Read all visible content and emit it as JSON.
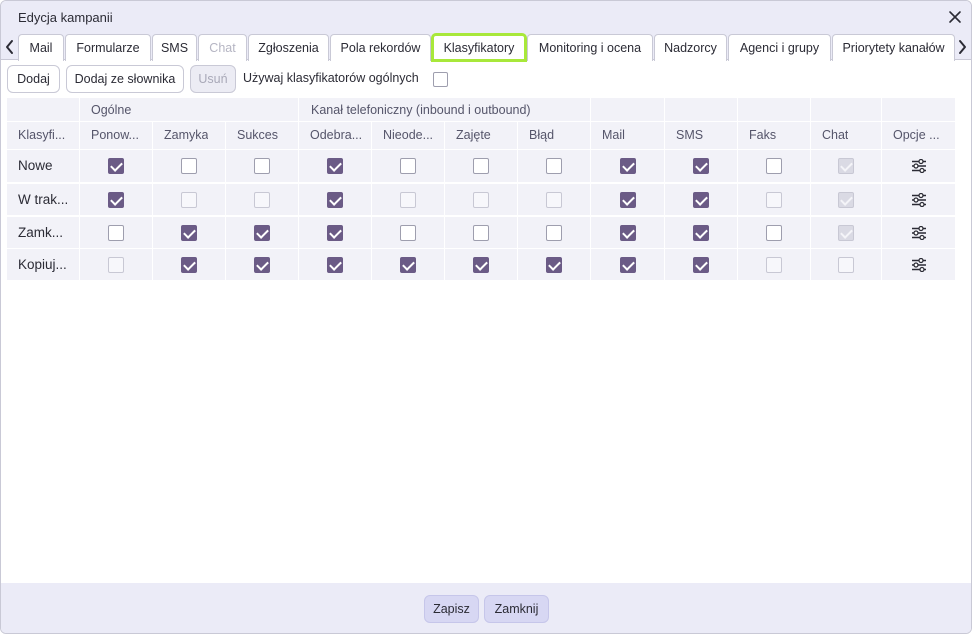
{
  "dialog": {
    "title": "Edycja kampanii"
  },
  "tabs": [
    {
      "label": "Mail",
      "state": "normal"
    },
    {
      "label": "Formularze",
      "state": "normal"
    },
    {
      "label": "SMS",
      "state": "normal"
    },
    {
      "label": "Chat",
      "state": "disabled"
    },
    {
      "label": "Zgłoszenia",
      "state": "normal"
    },
    {
      "label": "Pola rekordów",
      "state": "normal"
    },
    {
      "label": "Klasyfikatory",
      "state": "active"
    },
    {
      "label": "Monitoring i ocena",
      "state": "normal"
    },
    {
      "label": "Nadzorcy",
      "state": "normal"
    },
    {
      "label": "Agenci i grupy",
      "state": "normal"
    },
    {
      "label": "Priorytety kanałów",
      "state": "normal"
    }
  ],
  "toolbar": {
    "add_label": "Dodaj",
    "add_from_dict_label": "Dodaj ze słownika",
    "delete_label": "Usuń",
    "use_general_label": "Używaj klasyfikatorów ogólnych",
    "use_general_checked": false
  },
  "table": {
    "group_headers": {
      "general": "Ogólne",
      "phone": "Kanał telefoniczny (inbound i outbound)"
    },
    "columns": [
      "Klasyfi...",
      "Ponow...",
      "Zamyka",
      "Sukces",
      "Odebra...",
      "Nieode...",
      "Zajęte",
      "Błąd",
      "Mail",
      "SMS",
      "Faks",
      "Chat",
      "Opcje ..."
    ],
    "rows": [
      {
        "label": "Nowe",
        "checks": [
          true,
          false,
          false,
          true,
          false,
          false,
          false,
          true,
          true,
          false,
          true
        ],
        "disabled": [
          false,
          false,
          false,
          false,
          false,
          false,
          false,
          false,
          false,
          false,
          true
        ]
      },
      {
        "label": "W trak...",
        "checks": [
          true,
          false,
          false,
          true,
          false,
          false,
          false,
          true,
          true,
          false,
          true
        ],
        "disabled": [
          false,
          true,
          true,
          false,
          true,
          true,
          true,
          false,
          false,
          true,
          true
        ]
      },
      {
        "label": "Zamk...",
        "checks": [
          false,
          true,
          true,
          true,
          false,
          false,
          false,
          true,
          true,
          false,
          true
        ],
        "disabled": [
          false,
          false,
          false,
          false,
          false,
          false,
          false,
          false,
          false,
          false,
          true
        ]
      },
      {
        "label": "Kopiuj...",
        "checks": [
          false,
          true,
          true,
          true,
          true,
          true,
          true,
          true,
          true,
          false,
          false
        ],
        "disabled": [
          true,
          false,
          false,
          false,
          false,
          false,
          false,
          false,
          false,
          true,
          true
        ]
      }
    ]
  },
  "footer": {
    "save_label": "Zapisz",
    "close_label": "Zamknij"
  },
  "colors": {
    "accent": "#6b5b86",
    "active_tab_outline": "#a8e83a",
    "chrome_bg": "#ebebf7"
  },
  "icons": {
    "close": "close-icon",
    "prev": "chevron-left-icon",
    "next": "chevron-right-icon",
    "options": "sliders-icon"
  }
}
